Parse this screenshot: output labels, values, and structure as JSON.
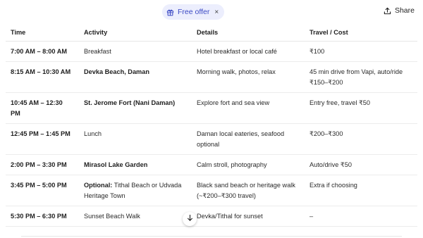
{
  "header": {
    "offer_label": "Free offer",
    "offer_close": "×",
    "share_label": "Share"
  },
  "table": {
    "columns": [
      "Time",
      "Activity",
      "Details",
      "Travel / Cost"
    ],
    "rows": [
      {
        "time": "7:00 AM – 8:00 AM",
        "activity_bold": "",
        "activity": "Breakfast",
        "details": "Hotel breakfast or local café",
        "travel": "₹100"
      },
      {
        "time": "8:15 AM – 10:30 AM",
        "activity_bold": "Devka Beach, Daman",
        "activity": "",
        "details": "Morning walk, photos, relax",
        "travel": "45 min drive from Vapi, auto/ride ₹150–₹200"
      },
      {
        "time": "10:45 AM – 12:30 PM",
        "activity_bold": "St. Jerome Fort (Nani Daman)",
        "activity": "",
        "details": "Explore fort and sea view",
        "travel": "Entry free, travel ₹50"
      },
      {
        "time": "12:45 PM – 1:45 PM",
        "activity_bold": "",
        "activity": "Lunch",
        "details": "Daman local eateries, seafood optional",
        "travel": "₹200–₹300"
      },
      {
        "time": "2:00 PM – 3:30 PM",
        "activity_bold": "Mirasol Lake Garden",
        "activity": "",
        "details": "Calm stroll, photography",
        "travel": "Auto/drive ₹50"
      },
      {
        "time": "3:45 PM – 5:00 PM",
        "activity_bold": "Optional:",
        "activity": " Tithal Beach or Udvada Heritage Town",
        "details": "Black sand beach or heritage walk (~₹200–₹300 travel)",
        "travel": "Extra if choosing"
      },
      {
        "time": "5:30 PM – 6:30 PM",
        "activity_bold": "",
        "activity": "Sunset Beach Walk",
        "details": "Devka/Tithal for sunset",
        "travel": "–"
      }
    ]
  },
  "icons": {
    "offer": "gift-icon",
    "share": "share-icon",
    "scroll": "arrow-down-icon"
  }
}
